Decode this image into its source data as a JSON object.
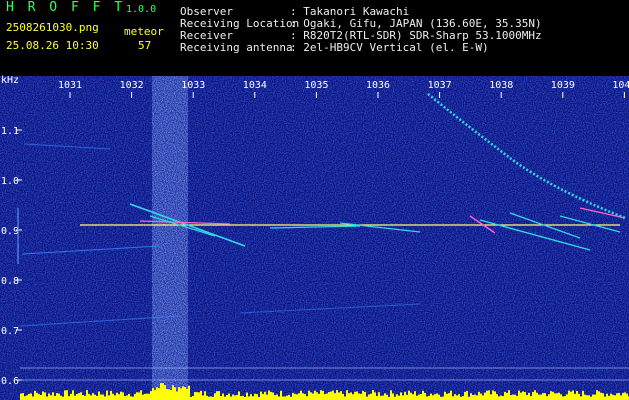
{
  "app": {
    "title": "H R O F F T",
    "version": "1.0.0",
    "file_name": "2508261030.png",
    "timestamp": "25.08.26 10:30",
    "counter_label": "meteor",
    "counter_value": "57"
  },
  "info": {
    "rows": [
      {
        "label": "Observer",
        "value": ": Takanori Kawachi"
      },
      {
        "label": "Receiving Location",
        "value": ": Ogaki, Gifu, JAPAN (136.60E, 35.35N)"
      },
      {
        "label": "Receiver",
        "value": ": R820T2(RTL-SDR) SDR-Sharp 53.1000MHz"
      },
      {
        "label": "Receiving antenna",
        "value": ": 2el-HB9CV Vertical (el. E-W)"
      }
    ]
  },
  "axis": {
    "unit": "kHz",
    "x_ticks": [
      "1031",
      "1032",
      "1033",
      "1034",
      "1035",
      "1036",
      "1037",
      "1038",
      "1039",
      "1040"
    ],
    "y_ticks": [
      "1.1",
      "1.0",
      "0.9",
      "0.8",
      "0.7",
      "0.6"
    ]
  },
  "colors": {
    "background": "#000000",
    "spectrogram": "#0a0f78",
    "header_text": "#ffff3a",
    "title": "#38ff5a",
    "carrier": "#ffff66",
    "echo": "#30d8e8",
    "level_bars": "#ffff00"
  }
}
